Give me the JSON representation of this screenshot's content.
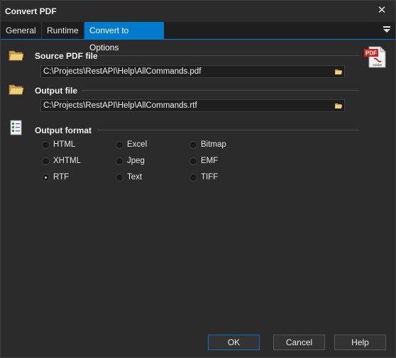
{
  "window": {
    "title": "Convert PDF"
  },
  "tabs": [
    {
      "label": "General"
    },
    {
      "label": "Runtime"
    },
    {
      "label": "Convert to Options"
    }
  ],
  "source": {
    "label": "Source PDF file",
    "value": "C:\\Projects\\RestAPI\\Help\\AllCommands.pdf"
  },
  "output": {
    "label": "Output file",
    "value": "C:\\Projects\\RestAPI\\Help\\AllCommands.rtf"
  },
  "format": {
    "label": "Output format",
    "options": [
      {
        "label": "HTML",
        "checked": false
      },
      {
        "label": "Excel",
        "checked": false
      },
      {
        "label": "Bitmap",
        "checked": false
      },
      {
        "label": "XHTML",
        "checked": false
      },
      {
        "label": "Jpeg",
        "checked": false
      },
      {
        "label": "EMF",
        "checked": false
      },
      {
        "label": "RTF",
        "checked": true
      },
      {
        "label": "Text",
        "checked": false
      },
      {
        "label": "TIFF",
        "checked": false
      }
    ],
    "selected": "RTF"
  },
  "adobe_icon": {
    "badge": "PDF",
    "caption": "Adobe"
  },
  "buttons": {
    "ok": "OK",
    "cancel": "Cancel",
    "help": "Help"
  },
  "icons": {
    "close": "close-icon",
    "tab_menu": "chevron-menu-icon",
    "folder": "folder-icon",
    "browse": "browse-folder-icon",
    "checklist": "checklist-icon",
    "pdf": "pdf-document-icon"
  }
}
